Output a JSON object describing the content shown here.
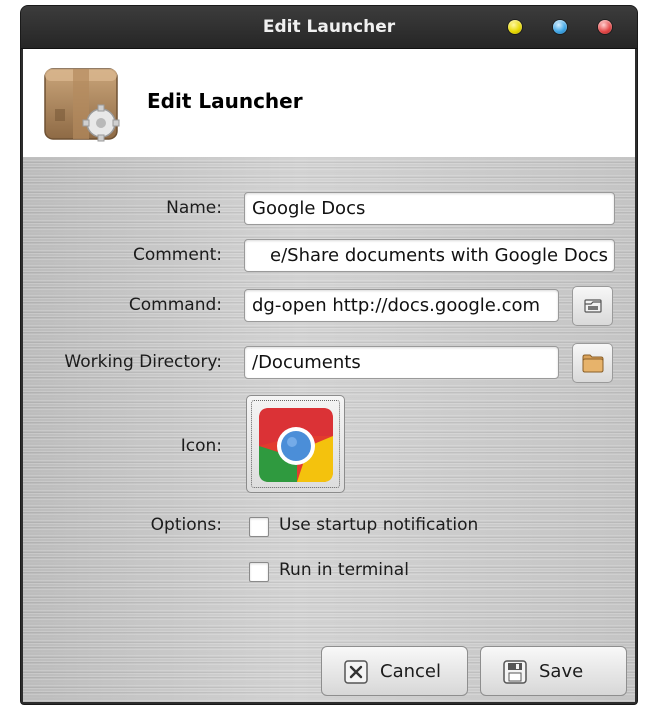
{
  "window": {
    "title": "Edit Launcher",
    "controls": [
      "minimize",
      "maximize",
      "close"
    ]
  },
  "header": {
    "title": "Edit Launcher",
    "icon": "package-settings-icon"
  },
  "form": {
    "name": {
      "label": "Name:",
      "value": "Google Docs"
    },
    "comment": {
      "label": "Comment:",
      "value": "e/Share documents with Google Docs"
    },
    "command": {
      "label": "Command:",
      "value": "dg-open http://docs.google.com",
      "browse_icon": "open-file-icon"
    },
    "working_directory": {
      "label": "Working Directory:",
      "value": "/Documents",
      "browse_icon": "folder-icon"
    },
    "icon": {
      "label": "Icon:",
      "value_icon": "chrome-icon"
    },
    "options": {
      "label": "Options:",
      "startup_notification": {
        "label": "Use startup notification",
        "checked": false
      },
      "run_in_terminal": {
        "label": "Run in terminal",
        "checked": false
      }
    }
  },
  "buttons": {
    "cancel": {
      "label": "Cancel",
      "icon": "cancel-x-icon"
    },
    "save": {
      "label": "Save",
      "icon": "save-disk-icon"
    }
  },
  "colors": {
    "titlebar": "#2d2d2d",
    "content_bg": "#c8c8c8",
    "minimize": "#e7d800",
    "maximize": "#3fa6e6",
    "close": "#e44848"
  }
}
